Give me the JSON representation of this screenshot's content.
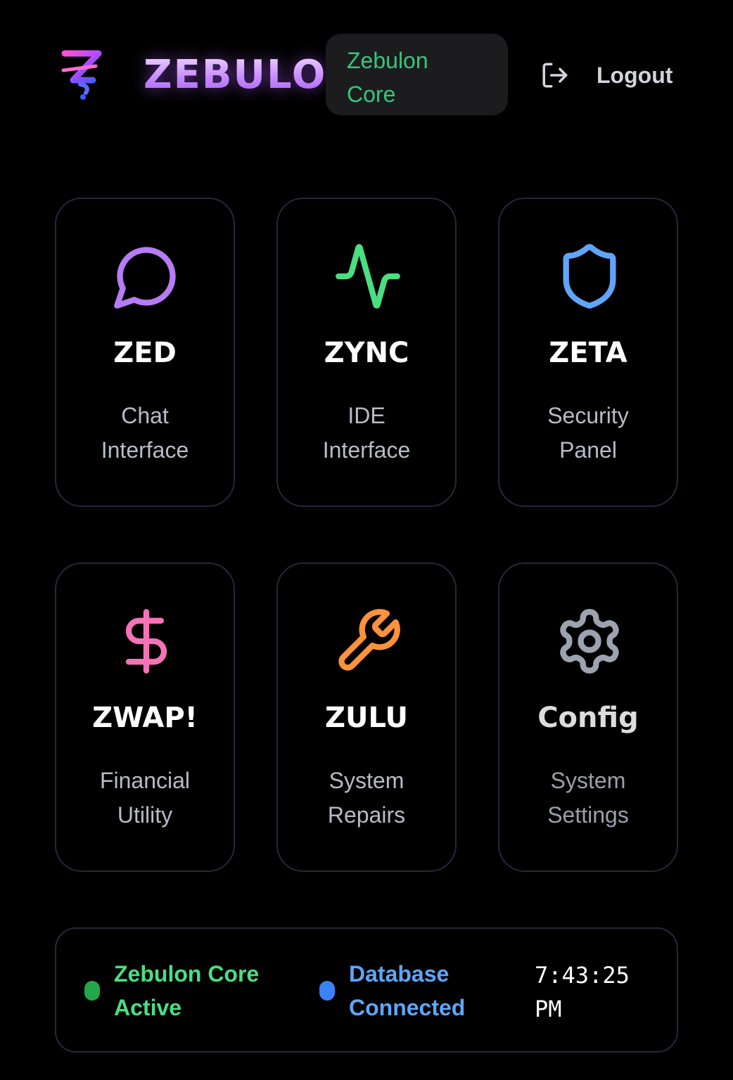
{
  "header": {
    "brand": "ZEBULON",
    "core_badge": {
      "line1": "Zebulon",
      "line2": "Core"
    },
    "logout_label": "Logout"
  },
  "cards": [
    {
      "title": "ZED",
      "desc": [
        "Chat",
        "Interface"
      ],
      "icon": "chat-bubble-icon",
      "color": "#b57cf5"
    },
    {
      "title": "ZYNC",
      "desc": [
        "IDE",
        "Interface"
      ],
      "icon": "activity-pulse-icon",
      "color": "#4ade80"
    },
    {
      "title": "ZETA",
      "desc": [
        "Security",
        "Panel"
      ],
      "icon": "shield-icon",
      "color": "#60a5fa"
    },
    {
      "title": "ZWAP!",
      "desc": [
        "Financial",
        "Utility"
      ],
      "icon": "dollar-icon",
      "color": "#f472b6"
    },
    {
      "title": "ZULU",
      "desc": [
        "System",
        "Repairs"
      ],
      "icon": "wrench-icon",
      "color": "#fb923c"
    },
    {
      "title": "Config",
      "desc": [
        "System",
        "Settings"
      ],
      "icon": "gear-icon",
      "color": "#9ca3af"
    }
  ],
  "status": {
    "core": {
      "line1": "Zebulon Core",
      "line2": "Active",
      "color": "#4ade80"
    },
    "database": {
      "line1": "Database",
      "line2": "Connected",
      "color": "#60a5fa"
    },
    "clock": {
      "time": "7:43:25",
      "period": "PM"
    }
  }
}
